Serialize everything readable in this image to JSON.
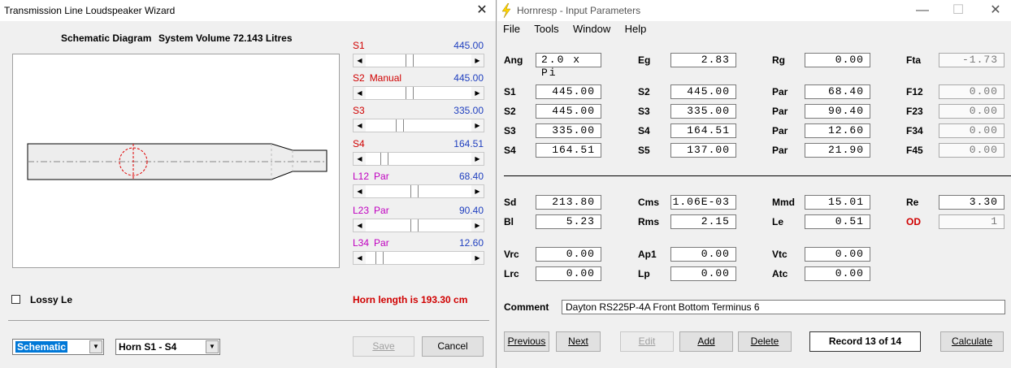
{
  "wizard": {
    "title": "Transmission Line Loudspeaker Wizard",
    "schematic_heading": "Schematic Diagram",
    "system_volume": "System Volume 72.143 Litres",
    "sliders": [
      {
        "name": "S1",
        "extra": "",
        "value": "445.00",
        "level": 0.4,
        "color": "red"
      },
      {
        "name": "S2",
        "extra": "Manual",
        "value": "445.00",
        "level": 0.4,
        "color": "red"
      },
      {
        "name": "S3",
        "extra": "",
        "value": "335.00",
        "level": 0.3,
        "color": "red"
      },
      {
        "name": "S4",
        "extra": "",
        "value": "164.51",
        "level": 0.15,
        "color": "red"
      },
      {
        "name": "L12",
        "extra": "Par",
        "value": "68.40",
        "level": 0.45,
        "color": "mag"
      },
      {
        "name": "L23",
        "extra": "Par",
        "value": "90.40",
        "level": 0.45,
        "color": "mag"
      },
      {
        "name": "L34",
        "extra": "Par",
        "value": "12.60",
        "level": 0.1,
        "color": "mag"
      }
    ],
    "lossy_le": "Lossy Le",
    "horn_length": "Horn length is 193.30 cm",
    "combo_view": "Schematic",
    "combo_horn": "Horn S1 - S4",
    "save": "Save",
    "cancel": "Cancel"
  },
  "hornresp": {
    "title": "Hornresp - Input Parameters",
    "menu": [
      "File",
      "Tools",
      "Window",
      "Help"
    ],
    "row_top": [
      {
        "label": "Ang",
        "value": "2.0 x Pi"
      },
      {
        "label": "Eg",
        "value": "2.83"
      },
      {
        "label": "Rg",
        "value": "0.00"
      },
      {
        "label": "Fta",
        "value": "-1.73"
      }
    ],
    "horn_rows": [
      [
        {
          "label": "S1",
          "value": "445.00"
        },
        {
          "label": "S2",
          "value": "445.00"
        },
        {
          "label": "Par",
          "value": "68.40"
        },
        {
          "label": "F12",
          "value": "0.00"
        }
      ],
      [
        {
          "label": "S2",
          "value": "445.00"
        },
        {
          "label": "S3",
          "value": "335.00"
        },
        {
          "label": "Par",
          "value": "90.40"
        },
        {
          "label": "F23",
          "value": "0.00"
        }
      ],
      [
        {
          "label": "S3",
          "value": "335.00"
        },
        {
          "label": "S4",
          "value": "164.51"
        },
        {
          "label": "Par",
          "value": "12.60"
        },
        {
          "label": "F34",
          "value": "0.00"
        }
      ],
      [
        {
          "label": "S4",
          "value": "164.51"
        },
        {
          "label": "S5",
          "value": "137.00"
        },
        {
          "label": "Par",
          "value": "21.90"
        },
        {
          "label": "F45",
          "value": "0.00"
        }
      ]
    ],
    "driver_rows": [
      [
        {
          "label": "Sd",
          "value": "213.80"
        },
        {
          "label": "Cms",
          "value": "1.06E-03"
        },
        {
          "label": "Mmd",
          "value": "15.01"
        },
        {
          "label": "Re",
          "value": "3.30"
        }
      ],
      [
        {
          "label": "Bl",
          "value": "5.23"
        },
        {
          "label": "Rms",
          "value": "2.15"
        },
        {
          "label": "Le",
          "value": "0.51"
        },
        {
          "label": "OD",
          "value": "1"
        }
      ]
    ],
    "chamber_rows": [
      [
        {
          "label": "Vrc",
          "value": "0.00"
        },
        {
          "label": "Ap1",
          "value": "0.00"
        },
        {
          "label": "Vtc",
          "value": "0.00"
        }
      ],
      [
        {
          "label": "Lrc",
          "value": "0.00"
        },
        {
          "label": "Lp",
          "value": "0.00"
        },
        {
          "label": "Atc",
          "value": "0.00"
        }
      ]
    ],
    "comment_label": "Comment",
    "comment": "Dayton RS225P-4A Front Bottom Terminus 6",
    "buttons": {
      "previous": "Previous",
      "next": "Next",
      "edit": "Edit",
      "add": "Add",
      "delete": "Delete",
      "record": "Record 13 of 14",
      "calculate": "Calculate"
    },
    "colors": {
      "od_label": "#d00000",
      "slider_value": "#1f3fbf"
    }
  }
}
